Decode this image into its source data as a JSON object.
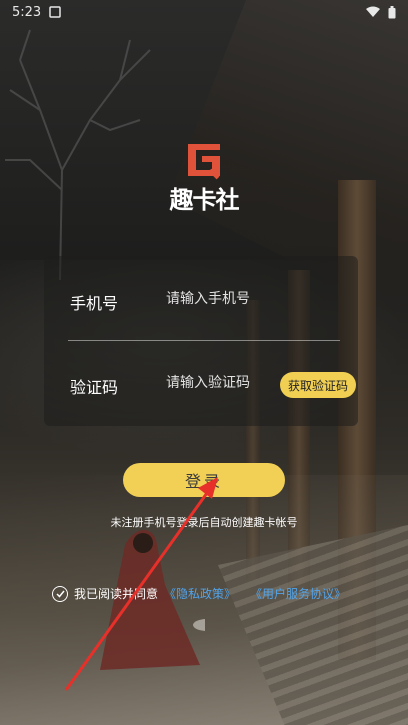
{
  "status_bar": {
    "time": "5:23",
    "icons": [
      "notification-box-icon",
      "wifi-icon",
      "battery-icon"
    ]
  },
  "logo": {
    "text": "趣卡社",
    "brand_color": "#e0533a"
  },
  "form": {
    "phone_label": "手机号",
    "phone_placeholder": "请输入手机号",
    "code_label": "验证码",
    "code_placeholder": "请输入验证码",
    "get_code_button": "获取验证码"
  },
  "login_button": "登录",
  "hint": "未注册手机号登录后自动创建趣卡帐号",
  "agreement": {
    "prefix": "我已阅读并同意",
    "privacy_link": "《隐私政策》",
    "service_link": "《用户服务协议》",
    "checked": true
  },
  "colors": {
    "accent": "#f2d056",
    "link": "#52a4ea"
  }
}
